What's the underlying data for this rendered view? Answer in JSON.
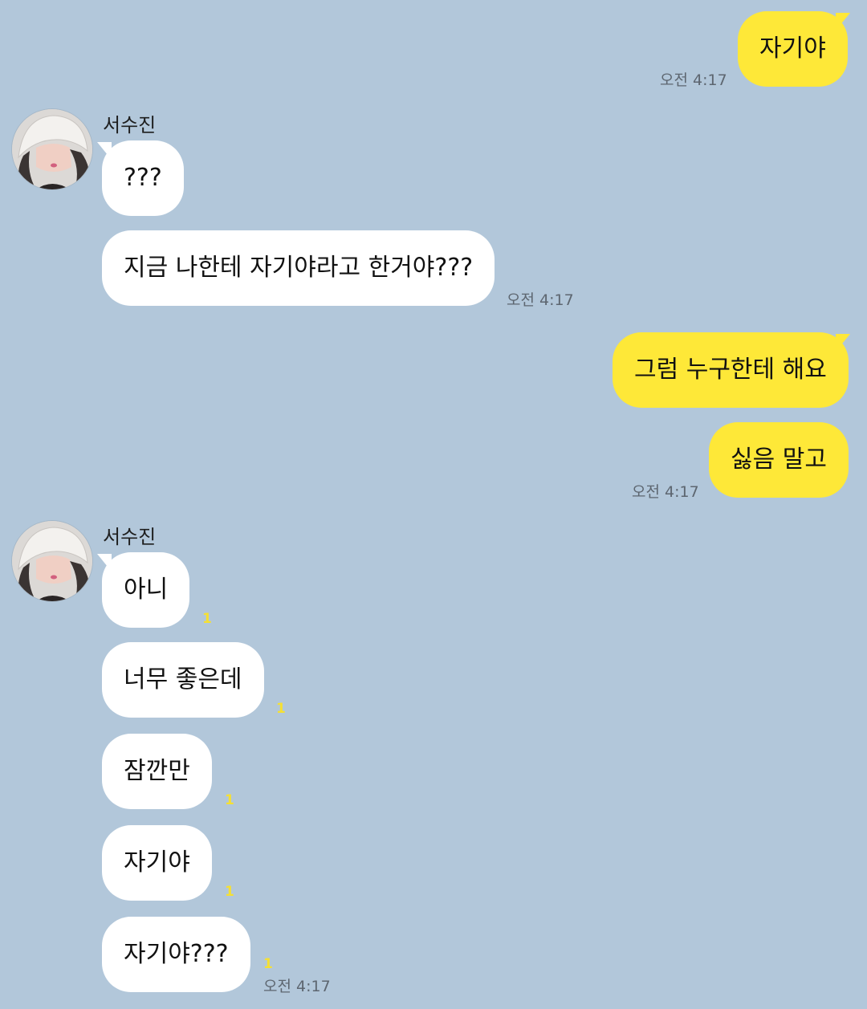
{
  "messages": [
    {
      "text": "자기야",
      "time": "오전 4:17"
    },
    {
      "sender": "서수진",
      "text": "???"
    },
    {
      "text": "지금 나한테 자기야라고 한거야???",
      "time": "오전 4:17"
    },
    {
      "text": "그럼 누구한테 해요"
    },
    {
      "text": "싫음 말고",
      "time": "오전 4:17"
    },
    {
      "sender": "서수진",
      "text": "아니",
      "unread": "1"
    },
    {
      "text": "너무 좋은데",
      "unread": "1"
    },
    {
      "text": "잠깐만",
      "unread": "1"
    },
    {
      "text": "자기야",
      "unread": "1"
    },
    {
      "text": "자기야???",
      "unread": "1",
      "time": "오전 4:17"
    }
  ],
  "colors": {
    "background": "#b2c7da",
    "incoming_bubble": "#ffffff",
    "outgoing_bubble": "#fee838",
    "unread_count": "#f5e033"
  },
  "icons": {
    "avatar": "profile-photo"
  }
}
